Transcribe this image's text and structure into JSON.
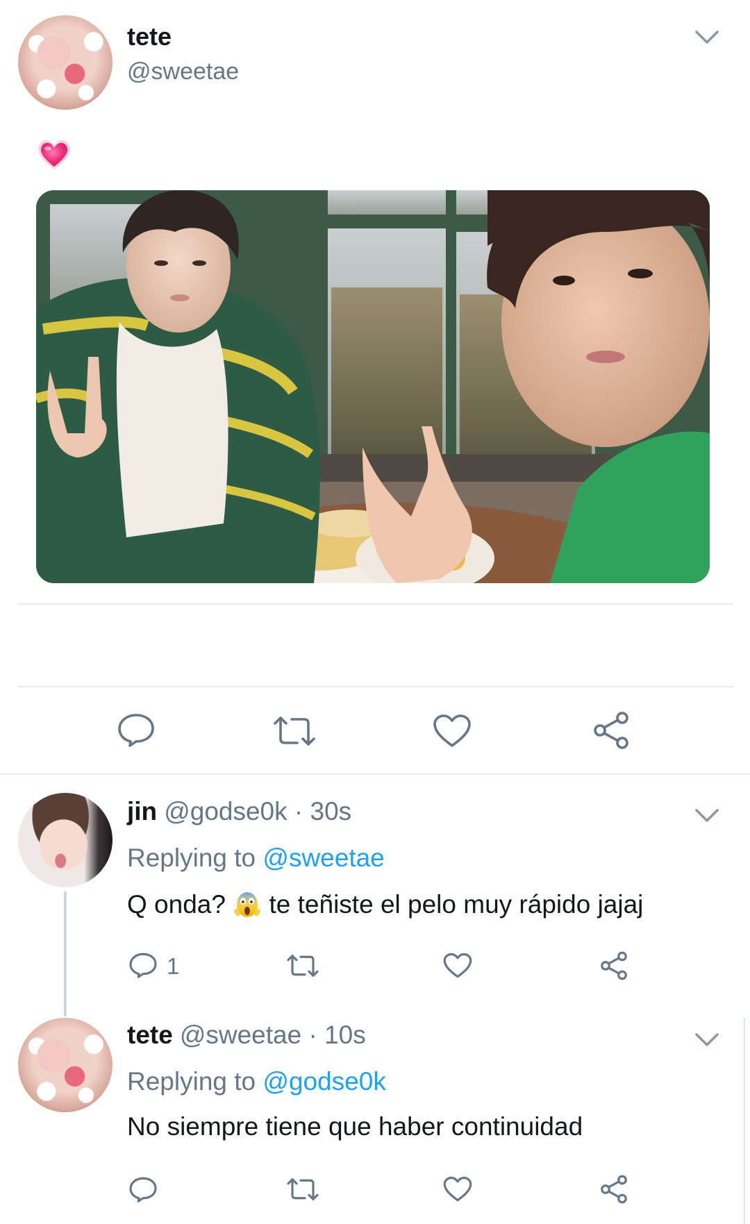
{
  "main_tweet": {
    "author_name": "tete",
    "author_handle": "@sweetae",
    "text_emoji": "heart-emoji",
    "photo_description": "photo-selfie"
  },
  "actions": [
    "reply-icon",
    "retweet-icon",
    "like-icon",
    "share-icon"
  ],
  "replies": [
    {
      "author_name": "jin",
      "author_handle": "@godse0k",
      "time": " · 30s",
      "replying_prefix": "Replying to ",
      "replying_to": "@sweetae",
      "text_before": "Q onda? ",
      "text_emoji": "scream-emoji",
      "text_after": " te teñiste el pelo muy rápido jajaj",
      "reply_count": "1"
    },
    {
      "author_name": "tete",
      "author_handle": "@sweetae",
      "time": " · 10s",
      "replying_prefix": "Replying to ",
      "replying_to": "@godse0k",
      "text": "No siempre tiene que haber continuidad"
    }
  ],
  "colors": {
    "secondary_text": "#657786",
    "link": "#1da1f2",
    "divider": "#e6ecf0",
    "icon": "#657786"
  }
}
